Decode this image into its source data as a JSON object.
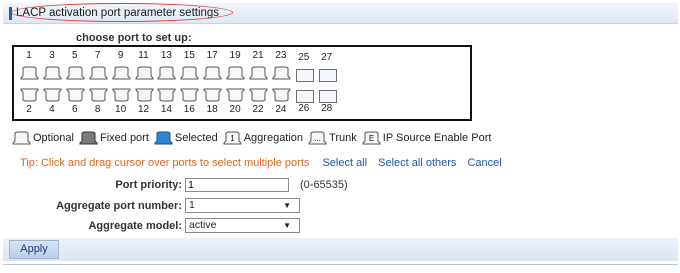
{
  "title": "LACP activation port parameter settings",
  "choose_label": "choose port to set up:",
  "ports": {
    "top_row": [
      "1",
      "3",
      "5",
      "7",
      "9",
      "11",
      "13",
      "15",
      "17",
      "19",
      "21",
      "23",
      "25",
      "27"
    ],
    "bottom_row": [
      "2",
      "4",
      "6",
      "8",
      "10",
      "12",
      "14",
      "16",
      "18",
      "20",
      "22",
      "24",
      "26",
      "28"
    ]
  },
  "legend": {
    "optional": "Optional",
    "fixed": "Fixed port",
    "selected": "Selected",
    "aggregation_icon": "1",
    "aggregation": "Aggregation",
    "trunk_icon": "...",
    "trunk": "Trunk",
    "ipsource_icon": "E",
    "ipsource": "IP Source Enable Port"
  },
  "tip": {
    "text": "Tip:  Click and drag cursor over ports to select multiple ports",
    "select_all": "Select all",
    "select_all_others": "Select all others",
    "cancel": "Cancel"
  },
  "form": {
    "port_priority_label": "Port priority:",
    "port_priority_value": "1",
    "port_priority_range": "(0-65535)",
    "aggregate_port_label": "Aggregate port number:",
    "aggregate_port_value": "1",
    "aggregate_model_label": "Aggregate model:",
    "aggregate_model_value": "active"
  },
  "apply_label": "Apply",
  "colors": {
    "title_accent": "#2b5aa8",
    "tip": "#e2661c",
    "link": "#2456a6",
    "highlight": "#d9443f"
  }
}
